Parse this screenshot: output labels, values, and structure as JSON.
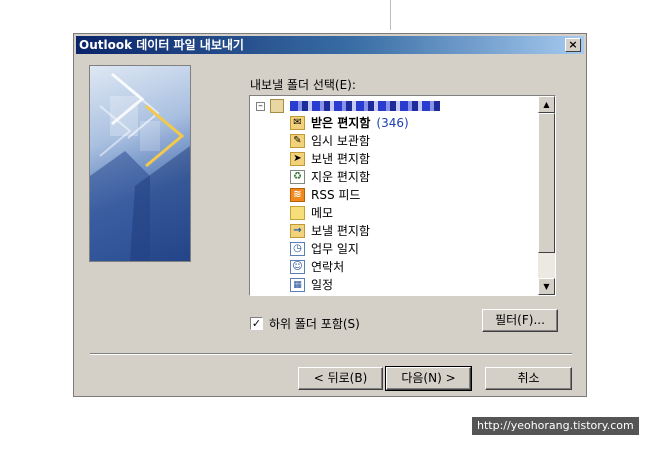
{
  "dialog": {
    "title": "Outlook 데이터 파일 내보내기",
    "close_label": "×"
  },
  "tree": {
    "label": "내보낼 폴더 선택(E):",
    "root_expander": "⊟",
    "folders": [
      {
        "label": "받은 편지함",
        "count": "(346)",
        "icon": "inbox-icon",
        "bold": true
      },
      {
        "label": "임시 보관함",
        "icon": "drafts-icon"
      },
      {
        "label": "보낸 편지함",
        "icon": "sent-items-icon"
      },
      {
        "label": "지운 편지함",
        "icon": "deleted-items-icon"
      },
      {
        "label": "RSS 피드",
        "icon": "rss-icon"
      },
      {
        "label": "메모",
        "icon": "notes-icon"
      },
      {
        "label": "보낼 편지함",
        "icon": "outbox-icon"
      },
      {
        "label": "업무 일지",
        "icon": "journal-icon"
      },
      {
        "label": "연락처",
        "icon": "contacts-icon"
      },
      {
        "label": "일정",
        "icon": "calendar-icon"
      }
    ]
  },
  "options": {
    "include_subfolders_label": "하위 폴더 포함(S)",
    "include_subfolders_checked": true,
    "check_mark": "✓",
    "filter_button": "필터(F)..."
  },
  "buttons": {
    "back": "< 뒤로(B)",
    "next": "다음(N) >",
    "cancel": "취소"
  },
  "watermark": "http://yeohorang.tistory.com",
  "colors": {
    "titlebar_start": "#0a246a",
    "titlebar_end": "#a6caf0",
    "dialog_bg": "#d4d0c8",
    "count_text": "#1f3fb0"
  }
}
